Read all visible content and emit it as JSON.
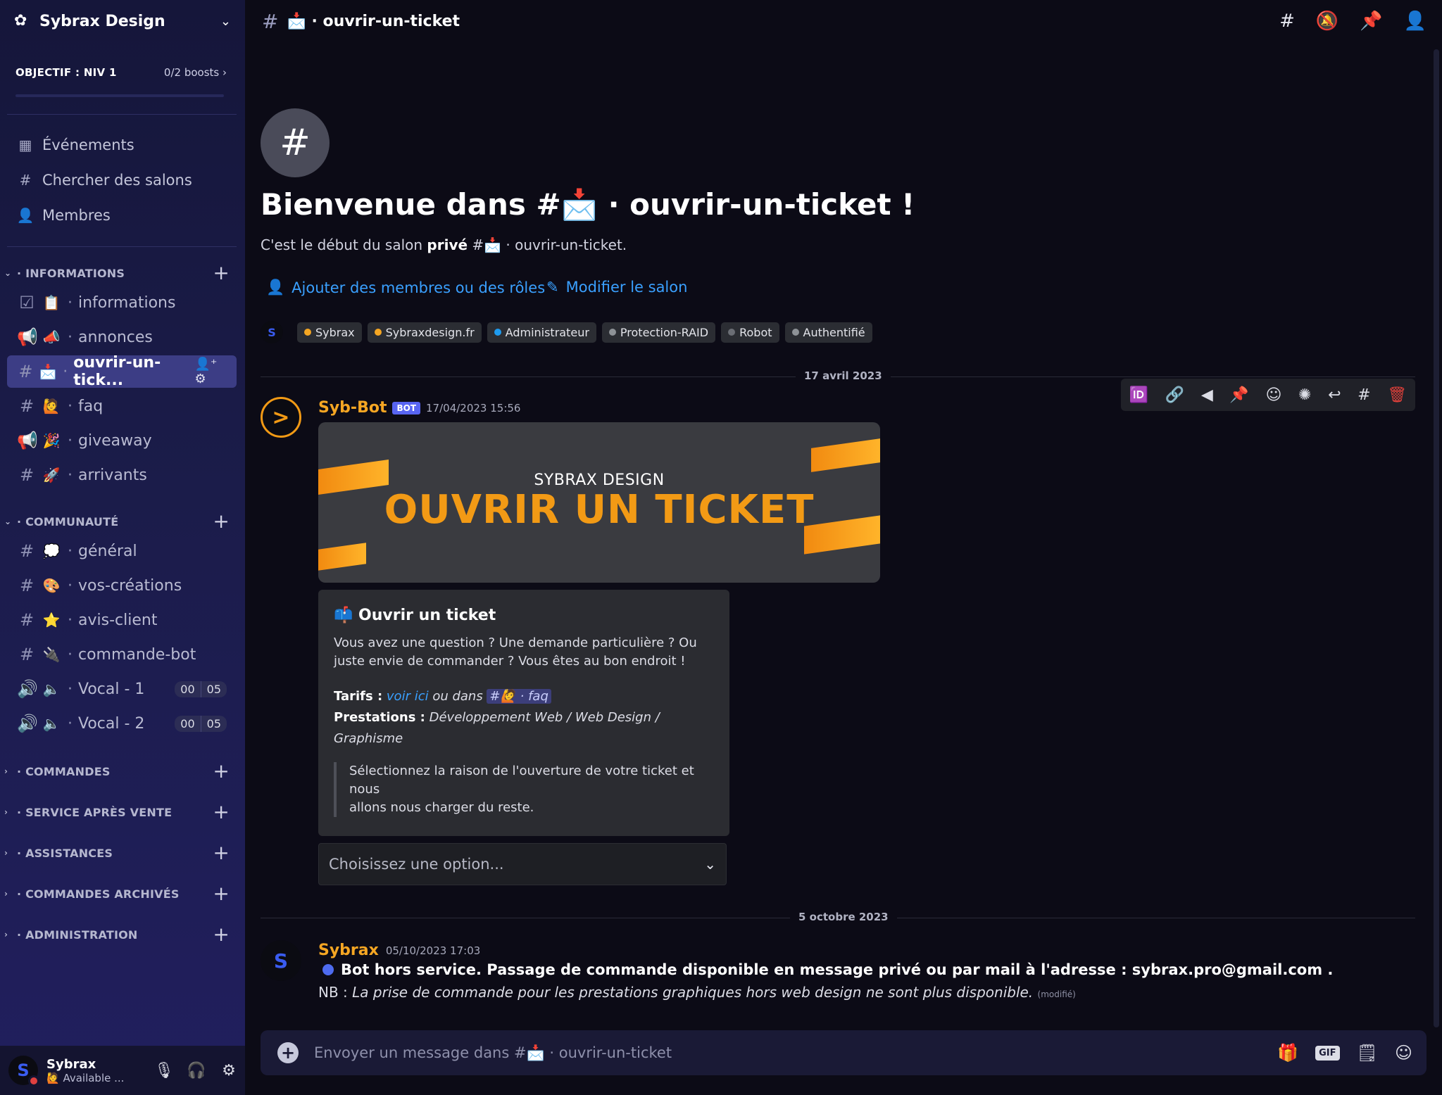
{
  "server": {
    "name": "Sybrax Design"
  },
  "boost": {
    "goal": "OBJECTIF : NIV 1",
    "count": "0/2 boosts"
  },
  "nav": [
    {
      "label": "Événements",
      "icon": "calendar-icon"
    },
    {
      "label": "Chercher des salons",
      "icon": "channel-search-icon"
    },
    {
      "label": "Membres",
      "icon": "members-icon"
    }
  ],
  "categories": {
    "informations": "INFORMATIONS",
    "communaute": "COMMUNAUTÉ",
    "commandes": "COMMANDES",
    "sav": "SERVICE APRÈS VENTE",
    "assistances": "ASSISTANCES",
    "archives": "COMMANDES ARCHIVÉS",
    "administration": "ADMINISTRATION"
  },
  "channels": {
    "informations": [
      "informations",
      "annonces",
      "ouvrir-un-tick...",
      "faq",
      "giveaway",
      "arrivants"
    ],
    "communaute": [
      "général",
      "vos-créations",
      "avis-client",
      "commande-bot",
      "Vocal - 1",
      "Vocal - 2"
    ]
  },
  "voice_counts": [
    [
      "00",
      "05"
    ],
    [
      "00",
      "05"
    ]
  ],
  "user": {
    "name": "Sybrax",
    "status": "Available ..."
  },
  "topbar": {
    "channel": "📩 · ouvrir-un-ticket"
  },
  "welcome": {
    "title": "Bienvenue dans #📩 · ouvrir-un-ticket !",
    "sub_pre": "C'est le début du salon ",
    "sub_bold": "privé",
    "sub_post": " #📩 · ouvrir-un-ticket.",
    "add_members": "Ajouter des membres ou des rôles",
    "edit_channel": "Modifier le salon"
  },
  "roles": [
    {
      "name": "Sybrax",
      "color": "#f5a623"
    },
    {
      "name": "Sybraxdesign.fr",
      "color": "#f5a623"
    },
    {
      "name": "Administrateur",
      "color": "#1e9bf0"
    },
    {
      "name": "Protection-RAID",
      "color": "#8e9297"
    },
    {
      "name": "Robot",
      "color": "#6b6e75"
    },
    {
      "name": "Authentifié",
      "color": "#8e9297"
    }
  ],
  "dates": {
    "first": "17 avril 2023",
    "second": "5 octobre 2023"
  },
  "message1": {
    "author": "Syb-Bot",
    "author_color": "#f5a623",
    "badge": "BOT",
    "time": "17/04/2023 15:56",
    "banner_small": "SYBRAX DESIGN",
    "banner_big": "OUVRIR UN TICKET",
    "embed_title": "📫 Ouvrir un ticket",
    "embed_desc": "Vous avez une question ? Une demande particulière ? Ou juste envie de commander ? Vous êtes au bon endroit !",
    "tarifs_label": "Tarifs :",
    "tarifs_link": "voir ici",
    "tarifs_mid": " ou dans ",
    "tarifs_mention": "#🙋 · faq",
    "prestations_label": "Prestations :",
    "prestations_value": "Développement Web / Web Design / Graphisme",
    "quote_1": "Sélectionnez la raison de l'ouverture de votre ticket et nous",
    "quote_2": "allons nous charger du reste.",
    "select_placeholder": "Choisissez une option..."
  },
  "message2": {
    "author": "Sybrax",
    "author_color": "#f5a623",
    "time": "05/10/2023 17:03",
    "line1": "Bot hors service. Passage de commande disponible en message privé ou par mail à l'adresse : sybrax.pro@gmail.com .",
    "nb_label": "NB : ",
    "nb_text": "La prise de commande pour les prestations graphiques hors web design ne sont plus disponible.",
    "edited": "(modifié)"
  },
  "composer": {
    "placeholder": "Envoyer un message dans #📩 · ouvrir-un-ticket",
    "gif": "GIF"
  }
}
